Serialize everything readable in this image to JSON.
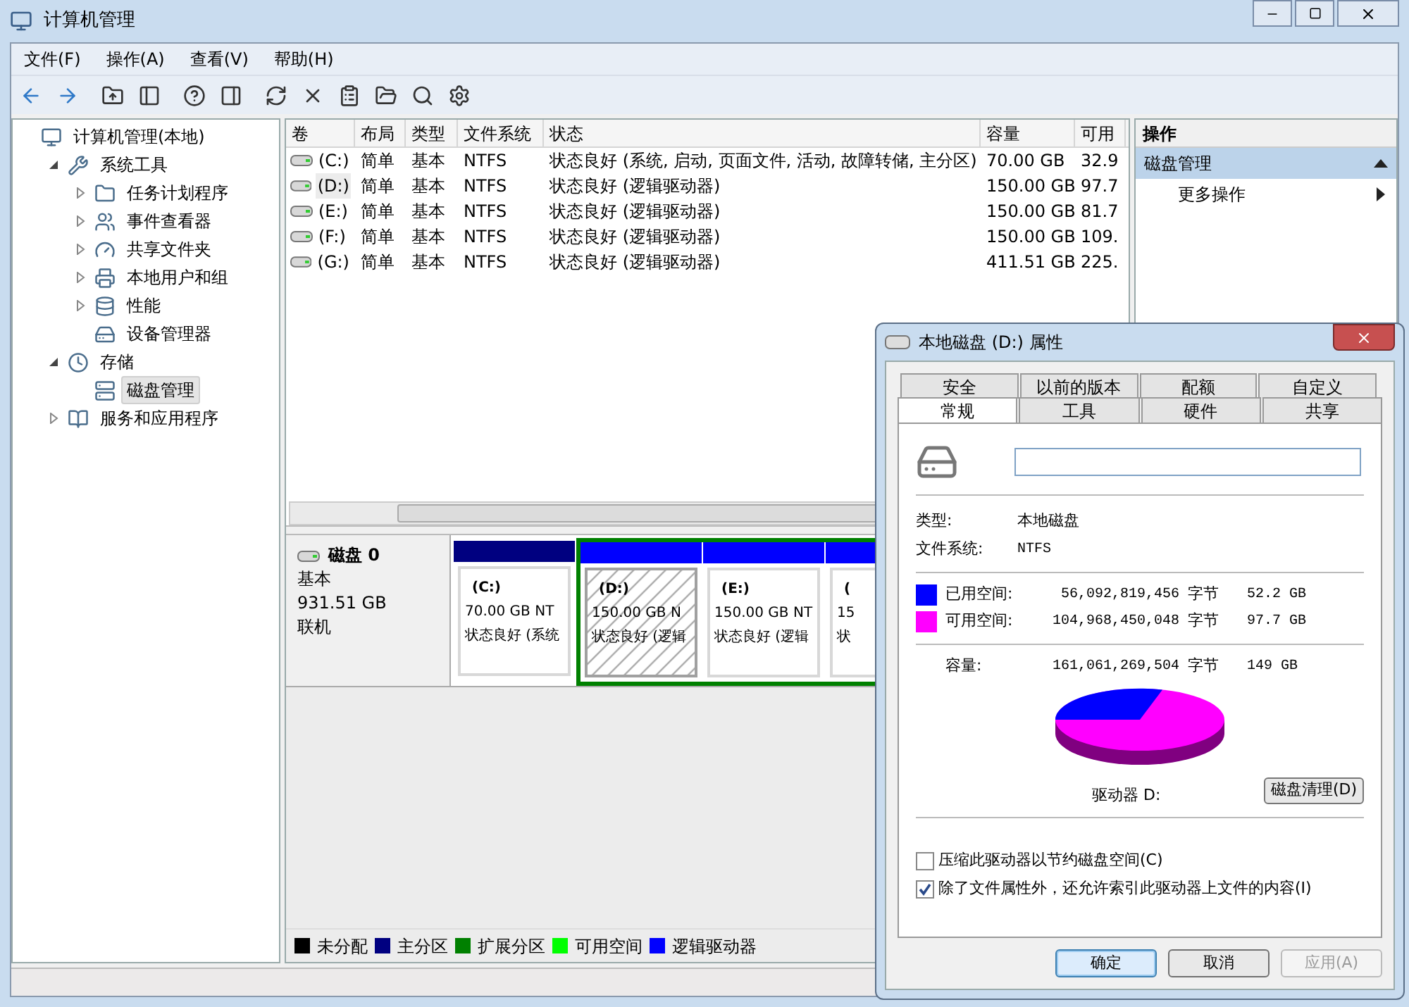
{
  "window": {
    "title": "计算机管理"
  },
  "menu": [
    {
      "label": "文件(F)"
    },
    {
      "label": "操作(A)"
    },
    {
      "label": "查看(V)"
    },
    {
      "label": "帮助(H)"
    }
  ],
  "tree": [
    {
      "label": "计算机管理(本地)",
      "selected": false,
      "children": [
        {
          "label": "系统工具",
          "selected": false,
          "expanded": true,
          "children": [
            {
              "label": "任务计划程序",
              "selected": false,
              "expanded": false
            },
            {
              "label": "事件查看器",
              "selected": false,
              "expanded": false
            },
            {
              "label": "共享文件夹",
              "selected": false,
              "expanded": false
            },
            {
              "label": "本地用户和组",
              "selected": false,
              "expanded": false
            },
            {
              "label": "性能",
              "selected": false,
              "expanded": false
            },
            {
              "label": "设备管理器",
              "selected": false
            }
          ]
        },
        {
          "label": "存储",
          "selected": false,
          "expanded": true,
          "children": [
            {
              "label": "磁盘管理",
              "selected": true
            }
          ]
        },
        {
          "label": "服务和应用程序",
          "selected": false,
          "expanded": false
        }
      ]
    }
  ],
  "table": {
    "columns": [
      "卷",
      "布局",
      "类型",
      "文件系统",
      "状态",
      "容量",
      "可用"
    ],
    "rows": [
      {
        "selected": false,
        "cells": [
          "(C:)",
          "简单",
          "基本",
          "NTFS",
          "状态良好 (系统, 启动, 页面文件, 活动, 故障转储, 主分区)",
          "70.00 GB",
          "32.9"
        ]
      },
      {
        "selected": true,
        "cells": [
          "(D:)",
          "简单",
          "基本",
          "NTFS",
          "状态良好 (逻辑驱动器)",
          "150.00 GB",
          "97.7"
        ]
      },
      {
        "selected": false,
        "cells": [
          "(E:)",
          "简单",
          "基本",
          "NTFS",
          "状态良好 (逻辑驱动器)",
          "150.00 GB",
          "81.7"
        ]
      },
      {
        "selected": false,
        "cells": [
          "(F:)",
          "简单",
          "基本",
          "NTFS",
          "状态良好 (逻辑驱动器)",
          "150.00 GB",
          "109."
        ]
      },
      {
        "selected": false,
        "cells": [
          "(G:)",
          "简单",
          "基本",
          "NTFS",
          "状态良好 (逻辑驱动器)",
          "411.51 GB",
          "225."
        ]
      }
    ]
  },
  "disk": {
    "name": "磁盘 0",
    "type": "基本",
    "size": "931.51 GB",
    "status": "联机",
    "partitions": [
      {
        "kind": "primary",
        "selected": false,
        "volume": "(C:)",
        "size": "70.00 GB NT",
        "status": "状态良好 (系统"
      }
    ],
    "extended": [
      {
        "kind": "logical",
        "selected": true,
        "volume": "(D:)",
        "size": "150.00 GB N",
        "status": "状态良好 (逻辑"
      },
      {
        "kind": "logical",
        "selected": false,
        "volume": "(E:)",
        "size": "150.00 GB NT",
        "status": "状态良好 (逻辑"
      },
      {
        "kind": "logical",
        "selected": false,
        "volume": "(",
        "size": "15",
        "status": "状"
      }
    ]
  },
  "legend": [
    {
      "label": "未分配",
      "color": "#000000"
    },
    {
      "label": "主分区",
      "color": "#000080"
    },
    {
      "label": "扩展分区",
      "color": "#008000"
    },
    {
      "label": "可用空间",
      "color": "#00ff00"
    },
    {
      "label": "逻辑驱动器",
      "color": "#0000ff"
    }
  ],
  "actions": {
    "title": "操作",
    "items": [
      {
        "kind": "section",
        "label": "磁盘管理"
      },
      {
        "kind": "more",
        "label": "更多操作"
      }
    ]
  },
  "dialog": {
    "title": "本地磁盘 (D:) 属性",
    "tab_rows": [
      [
        {
          "label": "安全",
          "selected": false
        },
        {
          "label": "以前的版本",
          "selected": false
        },
        {
          "label": "配额",
          "selected": false
        },
        {
          "label": "自定义",
          "selected": false
        }
      ],
      [
        {
          "label": "常规",
          "selected": true
        },
        {
          "label": "工具",
          "selected": false
        },
        {
          "label": "硬件",
          "selected": false
        },
        {
          "label": "共享",
          "selected": false
        }
      ]
    ],
    "type_label": "类型:",
    "type_value": "本地磁盘",
    "fs_label": "文件系统:",
    "fs_value": "NTFS",
    "space": [
      {
        "label": "已用空间:",
        "bytes": "56,092,819,456",
        "unit": "字节",
        "size": "52.2 GB",
        "color": "#0000ff"
      },
      {
        "label": "可用空间:",
        "bytes": "104,968,450,048",
        "unit": "字节",
        "size": "97.7 GB",
        "color": "#ff00ff"
      }
    ],
    "capacity": {
      "label": "容量:",
      "bytes": "161,061,269,504",
      "unit": "字节",
      "size": "149 GB"
    },
    "drive_label": "驱动器 D:",
    "cleanup_button": "磁盘清理(D)",
    "checkboxes": [
      {
        "label": "压缩此驱动器以节约磁盘空间(C)",
        "checked": false
      },
      {
        "label": "除了文件属性外，还允许索引此驱动器上文件的内容(I)",
        "checked": true
      }
    ],
    "buttons": [
      {
        "label": "确定",
        "disabled": false,
        "default": true
      },
      {
        "label": "取消",
        "disabled": false,
        "default": false
      },
      {
        "label": "应用(A)",
        "disabled": true,
        "default": false
      }
    ]
  }
}
